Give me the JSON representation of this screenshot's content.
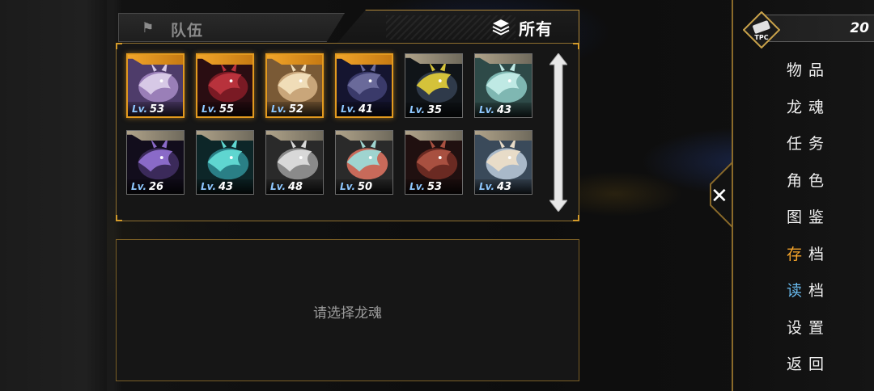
{
  "tabs": {
    "team_label": "队伍",
    "all_label": "所有"
  },
  "dragons": [
    {
      "lv_prefix": "Lv.",
      "level": "53",
      "in_team": true,
      "palette": [
        "#d7c9e6",
        "#9a7fb8",
        "#4e3c6a"
      ]
    },
    {
      "lv_prefix": "Lv.",
      "level": "55",
      "in_team": true,
      "palette": [
        "#b8323c",
        "#7a1a24",
        "#2a0d12"
      ]
    },
    {
      "lv_prefix": "Lv.",
      "level": "52",
      "in_team": true,
      "palette": [
        "#f0ddb8",
        "#c9a67a",
        "#7a5a36"
      ]
    },
    {
      "lv_prefix": "Lv.",
      "level": "41",
      "in_team": true,
      "palette": [
        "#6a6a9a",
        "#3a3a6a",
        "#151530"
      ]
    },
    {
      "lv_prefix": "Lv.",
      "level": "35",
      "in_team": false,
      "palette": [
        "#d4c23a",
        "#2f3a4a",
        "#101418"
      ]
    },
    {
      "lv_prefix": "Lv.",
      "level": "43",
      "in_team": false,
      "palette": [
        "#bfe9e4",
        "#7fb7b2",
        "#2e4a48"
      ]
    },
    {
      "lv_prefix": "Lv.",
      "level": "26",
      "in_team": false,
      "palette": [
        "#8a6ac8",
        "#3b2a5a",
        "#120d1c"
      ]
    },
    {
      "lv_prefix": "Lv.",
      "level": "43",
      "in_team": false,
      "palette": [
        "#5fd6d0",
        "#2a7f86",
        "#0d2628"
      ]
    },
    {
      "lv_prefix": "Lv.",
      "level": "48",
      "in_team": false,
      "palette": [
        "#d8d8d8",
        "#8a8a8a",
        "#2a2a2a"
      ]
    },
    {
      "lv_prefix": "Lv.",
      "level": "50",
      "in_team": false,
      "palette": [
        "#9fd4d0",
        "#c86a5a",
        "#2a2a2a"
      ]
    },
    {
      "lv_prefix": "Lv.",
      "level": "53",
      "in_team": false,
      "palette": [
        "#a85040",
        "#6a2a22",
        "#201010"
      ]
    },
    {
      "lv_prefix": "Lv.",
      "level": "43",
      "in_team": false,
      "palette": [
        "#e8dcc8",
        "#a9b9c9",
        "#3a4a5a"
      ]
    }
  ],
  "detail": {
    "placeholder": "请选择龙魂"
  },
  "currency": {
    "icon_label": "TPC",
    "amount": "20"
  },
  "menu": [
    {
      "label": "物品",
      "state": "normal"
    },
    {
      "label": "龙魂",
      "state": "normal"
    },
    {
      "label": "任务",
      "state": "normal"
    },
    {
      "label": "角色",
      "state": "normal"
    },
    {
      "label": "图鉴",
      "state": "normal"
    },
    {
      "label": "存档",
      "state": "save",
      "accent": "#f5a42a"
    },
    {
      "label": "读档",
      "state": "load",
      "accent": "#67b7ea"
    },
    {
      "label": "设置",
      "state": "normal"
    },
    {
      "label": "返回",
      "state": "normal"
    }
  ],
  "icons": {
    "team_tab": "flag-icon",
    "all_tab": "layers-icon",
    "close": "close-icon",
    "currency": "tpc-coin-icon",
    "scroll": "scroll-arrows-icon"
  },
  "colors": {
    "team_highlight": "#e39a1f",
    "panel_border": "#8f6f2e",
    "level_prefix": "#8fc8ff"
  }
}
